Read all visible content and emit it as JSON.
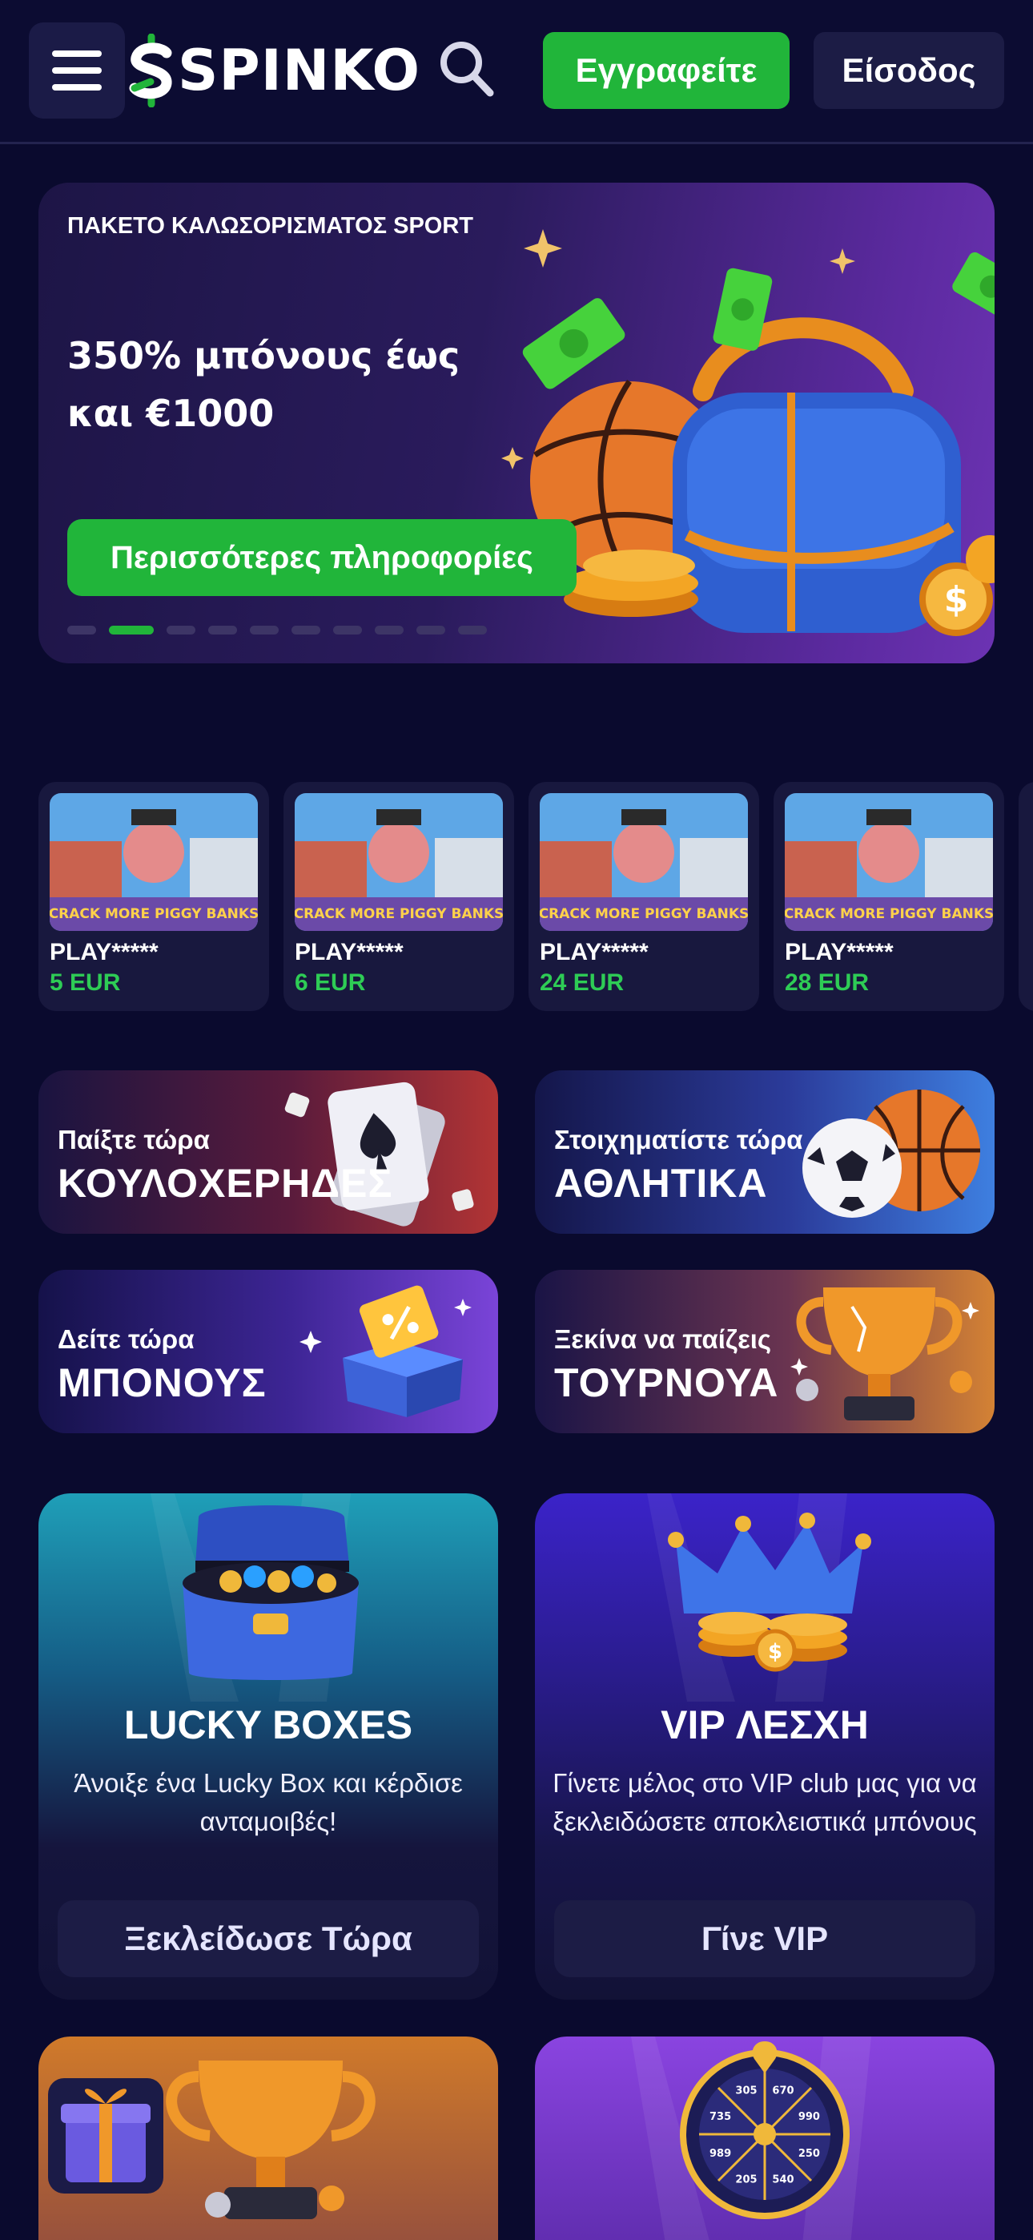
{
  "header": {
    "brand": "SPINKO",
    "register_label": "Εγγραφείτε",
    "login_label": "Είσοδος"
  },
  "hero": {
    "kicker": "ΠΑΚΕΤΟ ΚΑΛωΣΟΡΙΣΜΑΤΟΣ SPORT",
    "title_line1": "350% μπόνους έως",
    "title_line2": "και €1000",
    "cta_label": "Περισσότερες πληροφορίες",
    "slides_total": 10,
    "active_slide": 2
  },
  "games": [
    {
      "thumb_text": "CRACK MORE PIGGY BANKS",
      "name": "PLAY*****",
      "price": "5 EUR"
    },
    {
      "thumb_text": "CRACK MORE PIGGY BANKS",
      "name": "PLAY*****",
      "price": "6 EUR"
    },
    {
      "thumb_text": "CRACK MORE PIGGY BANKS",
      "name": "PLAY*****",
      "price": "24 EUR"
    },
    {
      "thumb_text": "CRACK MORE PIGGY BANKS",
      "name": "PLAY*****",
      "price": "28 EUR"
    }
  ],
  "categories": [
    {
      "sub": "Παίξτε τώρα",
      "title": "ΚΟΥΛΟΧΕΡΗΔΕΣ",
      "icon": "playing-cards-icon"
    },
    {
      "sub": "Στοιχηματίστε τώρα",
      "title": "ΑΘΛΗΤΙΚΑ",
      "icon": "sports-balls-icon"
    },
    {
      "sub": "Δείτε τώρα",
      "title": "ΜΠΟΝΟΥΣ",
      "icon": "bonus-box-icon"
    },
    {
      "sub": "Ξεκίνα να παίζεις",
      "title": "ΤΟΥΡΝΟΥΑ",
      "icon": "trophy-icon"
    }
  ],
  "features": [
    {
      "title": "LUCKY BOXES",
      "desc": "Άνοιξε ένα Lucky Box και κέρδισε ανταμοιβές!",
      "button": "Ξεκλείδωσε Τώρα"
    },
    {
      "title": "VIP ΛΕΣΧΗ",
      "desc": "Γίνετε μέλος στο VIP club μας για να ξεκλειδώσετε αποκλειστικά μπόνους",
      "button": "Γίνε VIP"
    }
  ],
  "wheel_labels": [
    "670",
    "990",
    "250",
    "540",
    "205",
    "989",
    "735",
    "305"
  ],
  "colors": {
    "background": "#0a0a2e",
    "accent_green": "#21b53a",
    "price_green": "#2ecc55",
    "card": "#18183e"
  }
}
